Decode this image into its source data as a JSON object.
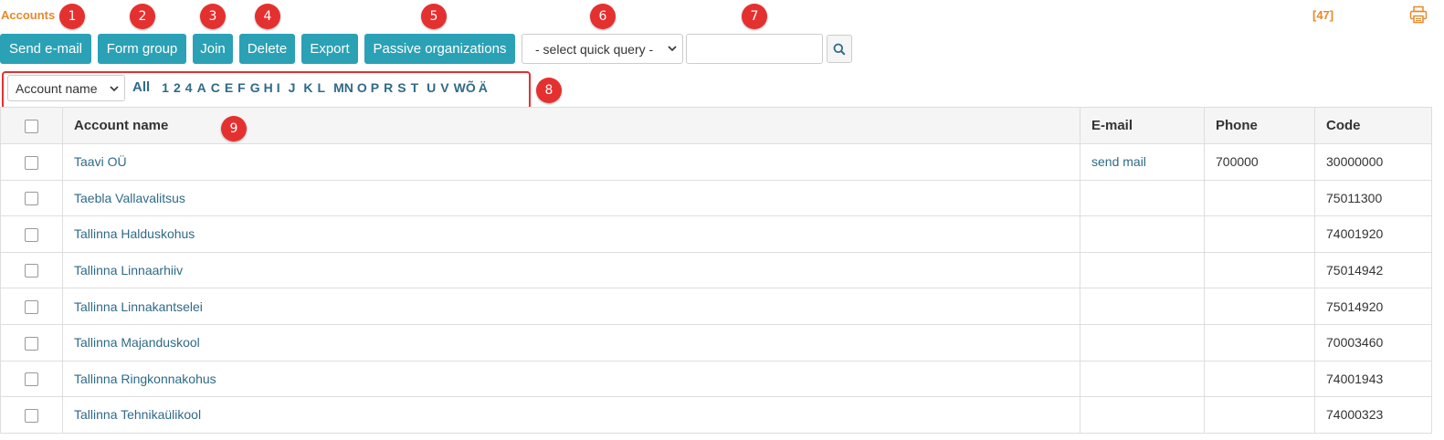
{
  "header": {
    "title": "Accounts",
    "count": "[47]",
    "print_icon": "printer-icon"
  },
  "markers": [
    "1",
    "2",
    "3",
    "4",
    "5",
    "6",
    "7",
    "8",
    "9"
  ],
  "toolbar": {
    "send_email": "Send e-mail",
    "form_group": "Form group",
    "join": "Join",
    "delete": "Delete",
    "export": "Export",
    "passive_orgs": "Passive organizations",
    "quick_query": "- select quick query -",
    "search_value": "",
    "search_icon": "search-icon"
  },
  "filter": {
    "field": "Account name",
    "all_label": "All",
    "letters": [
      "1",
      "2",
      "4",
      "A",
      "C",
      "E",
      "F",
      "G",
      "H",
      "I",
      "J",
      "K",
      "L",
      "M",
      "N",
      "O",
      "P",
      "R",
      "S",
      "T",
      "U",
      "V",
      "W",
      "Õ",
      "Ä"
    ]
  },
  "table": {
    "columns": [
      "Account name",
      "E-mail",
      "Phone",
      "Code"
    ],
    "rows": [
      {
        "name": "Taavi OÜ",
        "email": "send mail",
        "phone": "700000",
        "code": "30000000"
      },
      {
        "name": "Taebla Vallavalitsus",
        "email": "",
        "phone": "",
        "code": "75011300"
      },
      {
        "name": "Tallinna Halduskohus",
        "email": "",
        "phone": "",
        "code": "74001920"
      },
      {
        "name": "Tallinna Linnaarhiiv",
        "email": "",
        "phone": "",
        "code": "75014942"
      },
      {
        "name": "Tallinna Linnakantselei",
        "email": "",
        "phone": "",
        "code": "75014920"
      },
      {
        "name": "Tallinna Majanduskool",
        "email": "",
        "phone": "",
        "code": "70003460"
      },
      {
        "name": "Tallinna Ringkonnakohus",
        "email": "",
        "phone": "",
        "code": "74001943"
      },
      {
        "name": "Tallinna Tehnikaülikool",
        "email": "",
        "phone": "",
        "code": "74000323"
      }
    ]
  },
  "colors": {
    "accent_orange": "#e8892b",
    "button_teal": "#2ba1b5",
    "link_blue": "#2f6a87",
    "marker_red": "#e53030"
  }
}
